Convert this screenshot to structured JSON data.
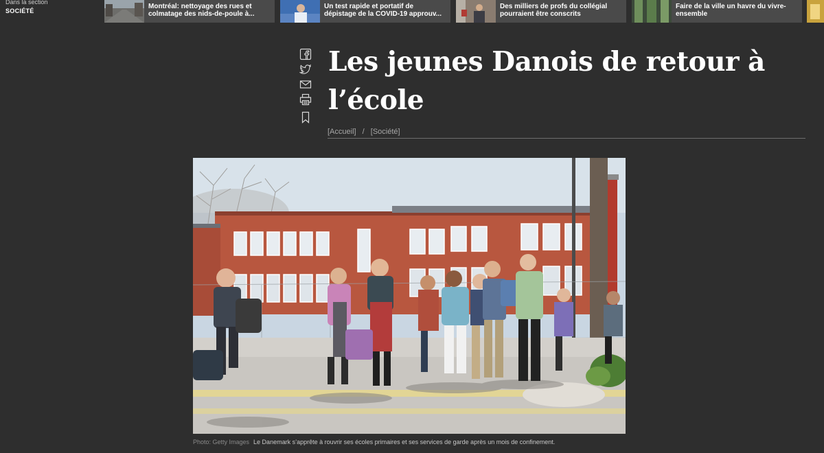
{
  "section": {
    "label": "Dans la section",
    "name": "SOCIÉTÉ"
  },
  "related": [
    {
      "text": "Montréal: nettoyage des rues et colmatage des nids-de-poule à..."
    },
    {
      "text": "Un test rapide et portatif de dépistage de la COVID-19 approuv..."
    },
    {
      "text": "Des milliers de profs du collégial pourraient être conscrits"
    },
    {
      "text": "Faire de la ville un havre du vivre-ensemble"
    }
  ],
  "social_icons": [
    "facebook-icon",
    "twitter-icon",
    "email-icon",
    "print-icon",
    "bookmark-icon"
  ],
  "article": {
    "title": "Les jeunes Danois de retour à l’école",
    "breadcrumb": {
      "home": "[Accueil]",
      "separator": "/",
      "section": "[Société]"
    },
    "photo": {
      "credit": "Photo: Getty Images",
      "caption": "Le Danemark s’apprête à rouvrir ses écoles primaires et ses services de garde après un mois de confinement."
    }
  },
  "colors": {
    "background": "#2e2e2e",
    "related_bg": "#4a4a4a",
    "text": "#ffffff",
    "muted": "#a8a8a8"
  }
}
